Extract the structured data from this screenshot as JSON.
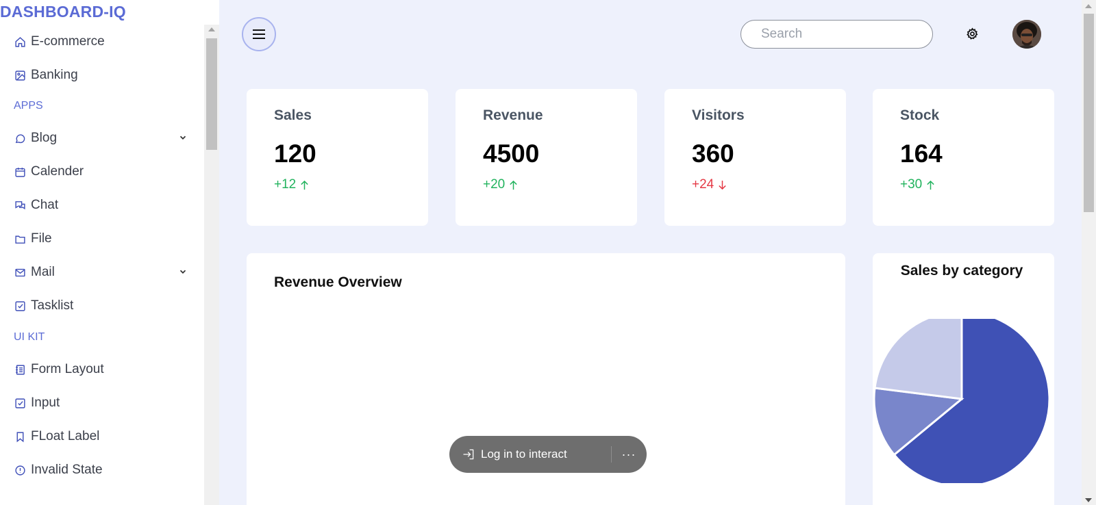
{
  "brand": "DASHBOARD-IQ",
  "sidebar": {
    "items": [
      {
        "label": "E-commerce",
        "icon": "home-icon"
      },
      {
        "label": "Banking",
        "icon": "image-icon"
      },
      {
        "label": "Blog",
        "icon": "chat-bubble-icon"
      },
      {
        "label": "Calender",
        "icon": "calendar-icon"
      },
      {
        "label": "Chat",
        "icon": "chats-icon"
      },
      {
        "label": "File",
        "icon": "folder-icon"
      },
      {
        "label": "Mail",
        "icon": "mail-icon"
      },
      {
        "label": "Tasklist",
        "icon": "checkbox-icon"
      },
      {
        "label": "Form Layout",
        "icon": "notebook-icon"
      },
      {
        "label": "Input",
        "icon": "checkbox-icon"
      },
      {
        "label": "FLoat Label",
        "icon": "bookmark-icon"
      },
      {
        "label": "Invalid State",
        "icon": "alert-circle-icon"
      }
    ],
    "sections": {
      "apps": "APPS",
      "uikit": "UI KIT"
    }
  },
  "header": {
    "search_placeholder": "Search"
  },
  "cards": [
    {
      "title": "Sales",
      "value": "120",
      "delta": "+12",
      "trend": "up"
    },
    {
      "title": "Revenue",
      "value": "4500",
      "delta": "+20",
      "trend": "up"
    },
    {
      "title": "Visitors",
      "value": "360",
      "delta": "+24",
      "trend": "down"
    },
    {
      "title": "Stock",
      "value": "164",
      "delta": "+30",
      "trend": "up"
    }
  ],
  "revenue_panel": {
    "title": "Revenue Overview"
  },
  "chart_data": {
    "type": "pie",
    "title": "Sales by category",
    "slices": [
      {
        "value": 64,
        "color": "#3f51b5"
      },
      {
        "value": 13,
        "color": "#7986cb"
      },
      {
        "value": 23,
        "color": "#c5cae9"
      }
    ]
  },
  "toast": {
    "login_label": "Log in to interact",
    "more_label": "···"
  },
  "colors": {
    "accent": "#5b6bd5",
    "positive": "#22b35e",
    "negative": "#e53945",
    "background": "#eef1fc"
  }
}
